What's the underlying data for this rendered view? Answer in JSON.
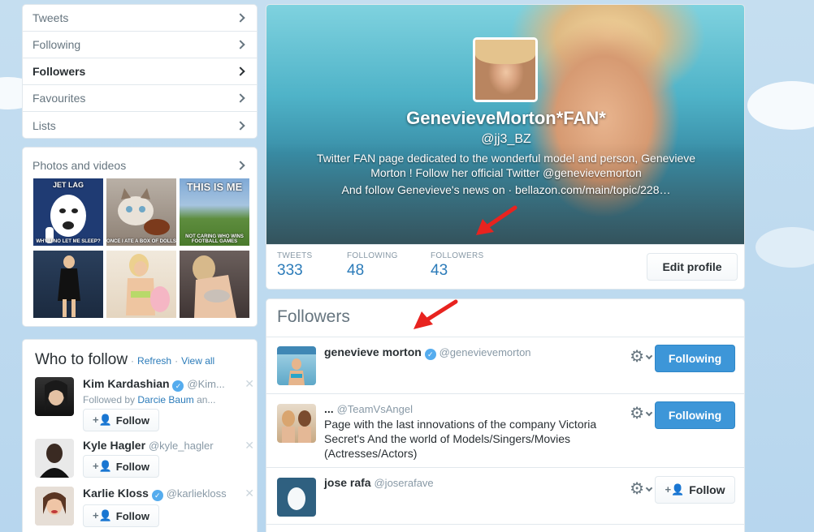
{
  "nav": {
    "items": [
      {
        "label": "Tweets",
        "active": false
      },
      {
        "label": "Following",
        "active": false
      },
      {
        "label": "Followers",
        "active": true
      },
      {
        "label": "Favourites",
        "active": false
      },
      {
        "label": "Lists",
        "active": false
      }
    ]
  },
  "photos": {
    "title": "Photos and videos",
    "captions": {
      "p1_top": "JET LAG",
      "p1_bottom": "WHY U NO LET ME SLEEP?",
      "p2_bottom": "ONCE I ATE A BOX OF DOLLS",
      "p3_top": "THIS IS ME",
      "p3_bottom": "NOT CARING WHO WINS FOOTBALL GAMES"
    }
  },
  "who_to_follow": {
    "title": "Who to follow",
    "refresh": "Refresh",
    "view_all": "View all",
    "dot": "·",
    "follow_label": "Follow",
    "suggestions": [
      {
        "name": "Kim Kardashian",
        "handle": "@Kim...",
        "context_prefix": "Followed by ",
        "context_name": "Darcie Baum",
        "context_suffix": " an...",
        "verified": true
      },
      {
        "name": "Kyle Hagler",
        "handle": "@kyle_hagler",
        "verified": false
      },
      {
        "name": "Karlie Kloss",
        "handle": "@karliekloss",
        "verified": true
      }
    ],
    "dismiss": "✕"
  },
  "profile": {
    "name": "GenevieveMorton*FAN*",
    "handle": "@jj3_BZ",
    "bio": "Twitter FAN page dedicated to the wonderful model and person, Genevieve Morton ! Follow her official Twitter @genevievemorton",
    "location_line": "And follow Genevieve's news on  ·  bellazon.com/main/topic/228…",
    "stats": [
      {
        "label": "TWEETS",
        "value": "333"
      },
      {
        "label": "FOLLOWING",
        "value": "48"
      },
      {
        "label": "FOLLOWERS",
        "value": "43"
      }
    ],
    "edit_label": "Edit profile"
  },
  "followers": {
    "title": "Followers",
    "rows": [
      {
        "name": "genevieve morton",
        "handle": "@genevievemorton",
        "bio": "",
        "verified": true,
        "button": "Following"
      },
      {
        "name": "...",
        "handle": "@TeamVsAngel",
        "bio": "Page with the last innovations of the company Victoria Secret's And the world of Models/Singers/Movies (Actresses/Actors)",
        "verified": false,
        "button": "Following"
      },
      {
        "name": "jose rafa",
        "handle": "@joserafave",
        "bio": "",
        "verified": false,
        "button": "Follow"
      }
    ]
  },
  "icons": {
    "gear": "⚙",
    "verified": "✓",
    "add_user": "+👤"
  },
  "colors": {
    "link": "#2b7bb9",
    "primary_button": "#3d96d8",
    "arrow": "#e8231f"
  }
}
